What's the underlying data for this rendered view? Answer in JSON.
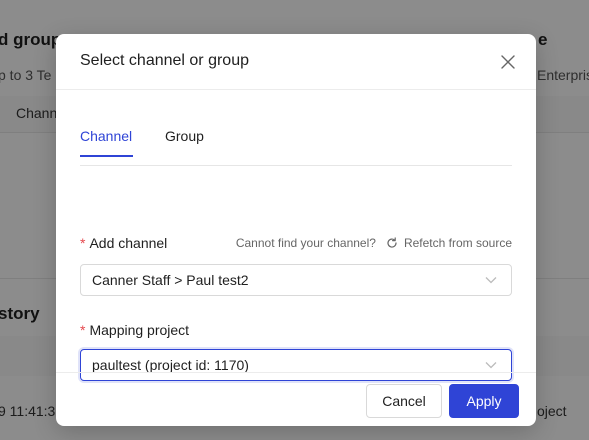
{
  "background": {
    "title_fragment": "d group",
    "title_fragment_right": "e",
    "subtitle_fragment": "p to 3 Te",
    "subtitle_fragment_right": "Enterpris",
    "column_fragment": "Chann",
    "section_fragment": "story",
    "row_time_fragment": "9 11:41:3",
    "row_right_fragment": "oject"
  },
  "modal": {
    "title": "Select channel or group",
    "tabs": [
      {
        "label": "Channel",
        "active": true
      },
      {
        "label": "Group",
        "active": false
      }
    ],
    "add_channel": {
      "label": "Add channel",
      "required_mark": "*",
      "hint_text": "Cannot find your channel?",
      "refetch_label": "Refetch from source",
      "value": "Canner Staff > Paul test2"
    },
    "mapping_project": {
      "label": "Mapping project",
      "required_mark": "*",
      "value": "paultest (project id: 1170)"
    },
    "cancel_label": "Cancel",
    "apply_label": "Apply"
  },
  "colors": {
    "accent": "#2f44d6",
    "required": "#e5484d"
  }
}
